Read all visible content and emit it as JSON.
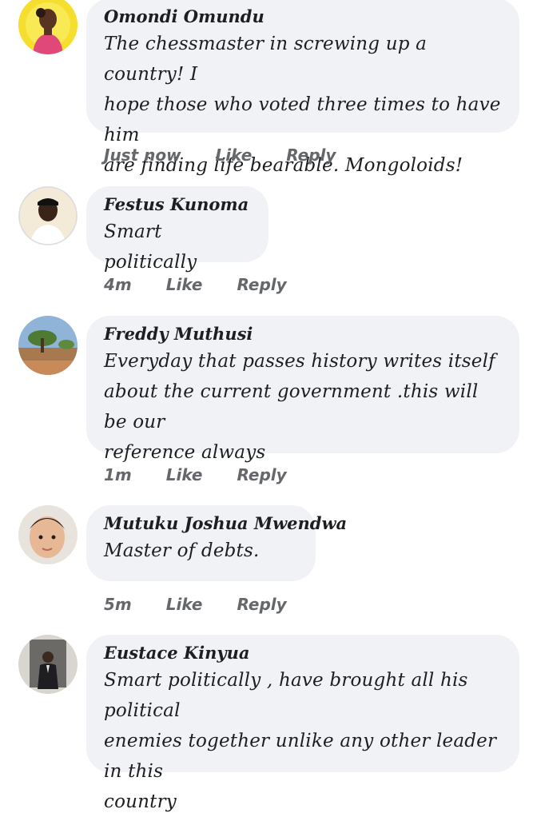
{
  "actions": {
    "like_label": "Like",
    "reply_label": "Reply"
  },
  "comments": [
    {
      "author": "Omondi Omundu",
      "lines": [
        "The chessmaster in screwing up a country! I",
        "hope those who voted three times to have him",
        "are finding life bearable. Mongoloids!"
      ],
      "time": "Just now",
      "avatar": "child-avatar"
    },
    {
      "author": "Festus Kunoma",
      "lines": [
        "Smart politically"
      ],
      "time": "4m",
      "avatar": "man-avatar"
    },
    {
      "author": "Freddy Muthusi",
      "lines": [
        "Everyday that passes history writes itself",
        "about the current government .this will be our",
        "reference always"
      ],
      "time": "1m",
      "avatar": "landscape-avatar"
    },
    {
      "author": "Mutuku Joshua Mwendwa",
      "lines": [
        "Master of debts."
      ],
      "time": "5m",
      "avatar": "baby-avatar"
    },
    {
      "author": "Eustace Kinyua",
      "lines": [
        "Smart politically , have brought all his political",
        "enemies together unlike any other leader in this",
        "country"
      ],
      "time": "",
      "avatar": "suited-man-avatar"
    }
  ]
}
